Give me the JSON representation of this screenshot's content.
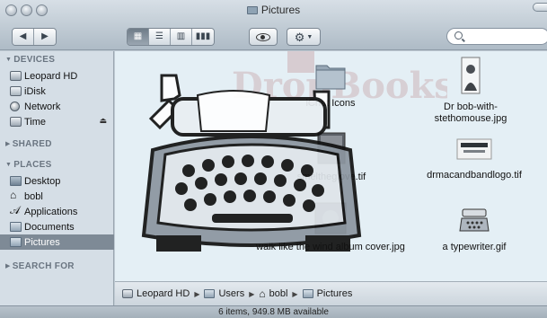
{
  "window": {
    "title": "Pictures"
  },
  "toolbar": {
    "back_icon": "back-arrow-icon",
    "forward_icon": "forward-arrow-icon",
    "view_modes": [
      "icon-view-icon",
      "list-view-icon",
      "column-view-icon",
      "coverflow-view-icon"
    ],
    "quicklook_icon": "eye-icon",
    "action_icon": "gear-icon",
    "search_placeholder": ""
  },
  "sidebar": {
    "devices_header": "DEVICES",
    "devices": [
      {
        "label": "Leopard HD",
        "icon": "hard-drive-icon"
      },
      {
        "label": "iDisk",
        "icon": "idisk-icon"
      },
      {
        "label": "Network",
        "icon": "network-globe-icon"
      },
      {
        "label": "Time",
        "icon": "drive-icon",
        "eject": "⏏"
      }
    ],
    "shared_header": "SHARED",
    "places_header": "PLACES",
    "places": [
      {
        "label": "Desktop",
        "icon": "desktop-icon"
      },
      {
        "label": "bobl",
        "icon": "home-icon"
      },
      {
        "label": "Applications",
        "icon": "applications-icon"
      },
      {
        "label": "Documents",
        "icon": "folder-icon"
      },
      {
        "label": "Pictures",
        "icon": "pictures-folder-icon",
        "selected": true
      }
    ],
    "search_header": "SEARCH FOR"
  },
  "files": [
    {
      "name": "iChat Icons"
    },
    {
      "name": "Dr bob-with-stethomouse.jpg"
    },
    {
      "name": "smeltheglove.tif"
    },
    {
      "name": "drmacandbandlogo.tif"
    },
    {
      "name": "walk like the wind album cover.jpg"
    },
    {
      "name": "a typewriter.gif"
    }
  ],
  "watermark": {
    "text": "DropBooks"
  },
  "path": [
    "Leopard HD",
    "Users",
    "bobl",
    "Pictures"
  ],
  "status": "6 items, 949.8 MB available"
}
